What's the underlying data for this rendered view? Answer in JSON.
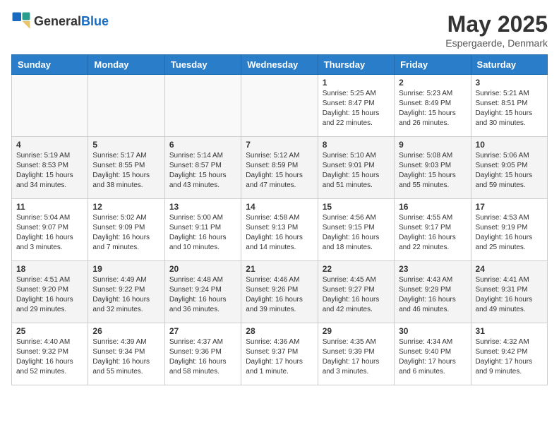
{
  "header": {
    "logo_general": "General",
    "logo_blue": "Blue",
    "month_title": "May 2025",
    "location": "Espergaerde, Denmark"
  },
  "weekdays": [
    "Sunday",
    "Monday",
    "Tuesday",
    "Wednesday",
    "Thursday",
    "Friday",
    "Saturday"
  ],
  "weeks": [
    [
      {
        "day": "",
        "info": ""
      },
      {
        "day": "",
        "info": ""
      },
      {
        "day": "",
        "info": ""
      },
      {
        "day": "",
        "info": ""
      },
      {
        "day": "1",
        "info": "Sunrise: 5:25 AM\nSunset: 8:47 PM\nDaylight: 15 hours\nand 22 minutes."
      },
      {
        "day": "2",
        "info": "Sunrise: 5:23 AM\nSunset: 8:49 PM\nDaylight: 15 hours\nand 26 minutes."
      },
      {
        "day": "3",
        "info": "Sunrise: 5:21 AM\nSunset: 8:51 PM\nDaylight: 15 hours\nand 30 minutes."
      }
    ],
    [
      {
        "day": "4",
        "info": "Sunrise: 5:19 AM\nSunset: 8:53 PM\nDaylight: 15 hours\nand 34 minutes."
      },
      {
        "day": "5",
        "info": "Sunrise: 5:17 AM\nSunset: 8:55 PM\nDaylight: 15 hours\nand 38 minutes."
      },
      {
        "day": "6",
        "info": "Sunrise: 5:14 AM\nSunset: 8:57 PM\nDaylight: 15 hours\nand 43 minutes."
      },
      {
        "day": "7",
        "info": "Sunrise: 5:12 AM\nSunset: 8:59 PM\nDaylight: 15 hours\nand 47 minutes."
      },
      {
        "day": "8",
        "info": "Sunrise: 5:10 AM\nSunset: 9:01 PM\nDaylight: 15 hours\nand 51 minutes."
      },
      {
        "day": "9",
        "info": "Sunrise: 5:08 AM\nSunset: 9:03 PM\nDaylight: 15 hours\nand 55 minutes."
      },
      {
        "day": "10",
        "info": "Sunrise: 5:06 AM\nSunset: 9:05 PM\nDaylight: 15 hours\nand 59 minutes."
      }
    ],
    [
      {
        "day": "11",
        "info": "Sunrise: 5:04 AM\nSunset: 9:07 PM\nDaylight: 16 hours\nand 3 minutes."
      },
      {
        "day": "12",
        "info": "Sunrise: 5:02 AM\nSunset: 9:09 PM\nDaylight: 16 hours\nand 7 minutes."
      },
      {
        "day": "13",
        "info": "Sunrise: 5:00 AM\nSunset: 9:11 PM\nDaylight: 16 hours\nand 10 minutes."
      },
      {
        "day": "14",
        "info": "Sunrise: 4:58 AM\nSunset: 9:13 PM\nDaylight: 16 hours\nand 14 minutes."
      },
      {
        "day": "15",
        "info": "Sunrise: 4:56 AM\nSunset: 9:15 PM\nDaylight: 16 hours\nand 18 minutes."
      },
      {
        "day": "16",
        "info": "Sunrise: 4:55 AM\nSunset: 9:17 PM\nDaylight: 16 hours\nand 22 minutes."
      },
      {
        "day": "17",
        "info": "Sunrise: 4:53 AM\nSunset: 9:19 PM\nDaylight: 16 hours\nand 25 minutes."
      }
    ],
    [
      {
        "day": "18",
        "info": "Sunrise: 4:51 AM\nSunset: 9:20 PM\nDaylight: 16 hours\nand 29 minutes."
      },
      {
        "day": "19",
        "info": "Sunrise: 4:49 AM\nSunset: 9:22 PM\nDaylight: 16 hours\nand 32 minutes."
      },
      {
        "day": "20",
        "info": "Sunrise: 4:48 AM\nSunset: 9:24 PM\nDaylight: 16 hours\nand 36 minutes."
      },
      {
        "day": "21",
        "info": "Sunrise: 4:46 AM\nSunset: 9:26 PM\nDaylight: 16 hours\nand 39 minutes."
      },
      {
        "day": "22",
        "info": "Sunrise: 4:45 AM\nSunset: 9:27 PM\nDaylight: 16 hours\nand 42 minutes."
      },
      {
        "day": "23",
        "info": "Sunrise: 4:43 AM\nSunset: 9:29 PM\nDaylight: 16 hours\nand 46 minutes."
      },
      {
        "day": "24",
        "info": "Sunrise: 4:41 AM\nSunset: 9:31 PM\nDaylight: 16 hours\nand 49 minutes."
      }
    ],
    [
      {
        "day": "25",
        "info": "Sunrise: 4:40 AM\nSunset: 9:32 PM\nDaylight: 16 hours\nand 52 minutes."
      },
      {
        "day": "26",
        "info": "Sunrise: 4:39 AM\nSunset: 9:34 PM\nDaylight: 16 hours\nand 55 minutes."
      },
      {
        "day": "27",
        "info": "Sunrise: 4:37 AM\nSunset: 9:36 PM\nDaylight: 16 hours\nand 58 minutes."
      },
      {
        "day": "28",
        "info": "Sunrise: 4:36 AM\nSunset: 9:37 PM\nDaylight: 17 hours\nand 1 minute."
      },
      {
        "day": "29",
        "info": "Sunrise: 4:35 AM\nSunset: 9:39 PM\nDaylight: 17 hours\nand 3 minutes."
      },
      {
        "day": "30",
        "info": "Sunrise: 4:34 AM\nSunset: 9:40 PM\nDaylight: 17 hours\nand 6 minutes."
      },
      {
        "day": "31",
        "info": "Sunrise: 4:32 AM\nSunset: 9:42 PM\nDaylight: 17 hours\nand 9 minutes."
      }
    ]
  ]
}
